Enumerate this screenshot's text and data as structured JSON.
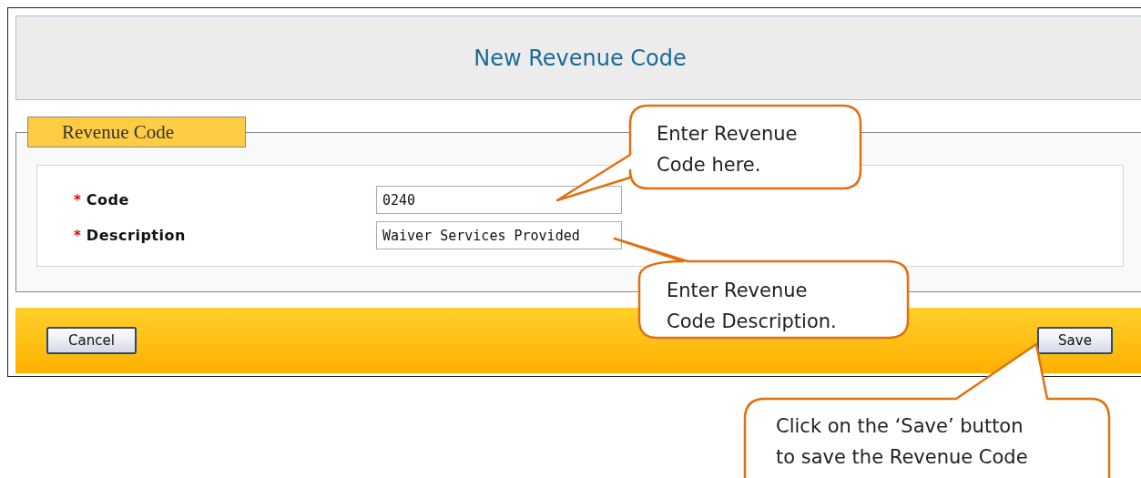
{
  "header": {
    "title": "New Revenue Code"
  },
  "section": {
    "legend": "Revenue Code",
    "fields": [
      {
        "required_mark": "*",
        "label": "Code",
        "value": "0240"
      },
      {
        "required_mark": "*",
        "label": "Description",
        "value": "Waiver Services Provided"
      }
    ]
  },
  "footer": {
    "buttons": [
      {
        "label": "Cancel",
        "kind": "left"
      },
      {
        "label": "Save",
        "kind": "right"
      }
    ]
  },
  "callouts": [
    {
      "text": "Enter Revenue\nCode here.",
      "kind": "code"
    },
    {
      "text": "Enter Revenue\nCode Description.",
      "kind": "description"
    },
    {
      "text": "Click on the ‘Save’ button\nto save the Revenue Code",
      "kind": "save"
    }
  ]
}
